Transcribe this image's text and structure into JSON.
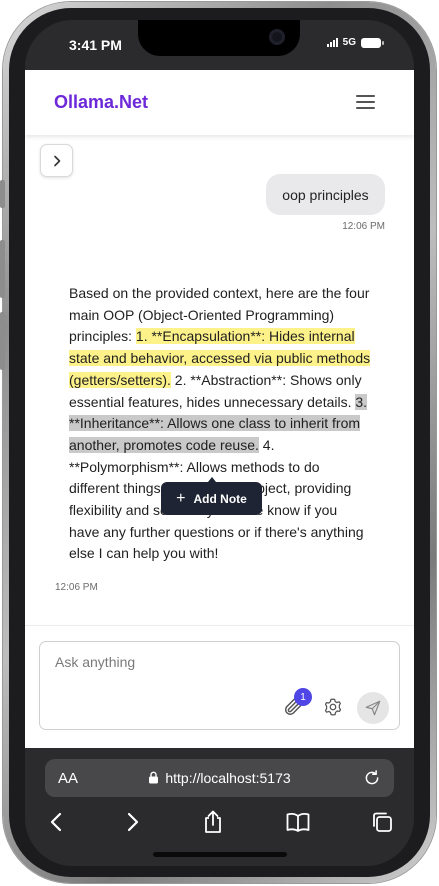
{
  "status_bar": {
    "time": "3:41 PM",
    "network": "5G"
  },
  "app": {
    "brand": "Ollama.Net"
  },
  "messages": {
    "user": {
      "text": "oop principles",
      "time": "12:06 PM"
    },
    "assistant": {
      "segments": [
        {
          "text": "Based on the provided context, here are the four main OOP (Object-Oriented Programming) principles: ",
          "highlight": "none"
        },
        {
          "text": "1. **Encapsulation**: Hides internal state and behavior, accessed via public methods (getters/setters).",
          "highlight": "yellow"
        },
        {
          "text": " 2. **Abstraction**: Shows only essential features, hides unnecessary details. ",
          "highlight": "none"
        },
        {
          "text": "3. **Inheritance**: Allows one class to inherit from another, promotes code reuse.",
          "highlight": "gray"
        },
        {
          "text": " 4. **Polymorphism**: Allows methods to do different things based on the object, providing flexibility and scalability. Let me know if you have any further questions or if there's anything else I can help you with!",
          "highlight": "none"
        }
      ],
      "time": "12:06 PM"
    }
  },
  "selection_popover": {
    "label": "Add Note",
    "icon": "plus-icon"
  },
  "composer": {
    "placeholder": "Ask anything",
    "attachment_count": "1"
  },
  "browser": {
    "text_size_label": "AA",
    "url": "http://localhost:5173"
  },
  "colors": {
    "brand": "#6d28d9",
    "highlight_yellow": "#fdf28a",
    "highlight_gray": "#c9c9c9",
    "badge": "#4f46e5",
    "popover": "#1e2433"
  }
}
